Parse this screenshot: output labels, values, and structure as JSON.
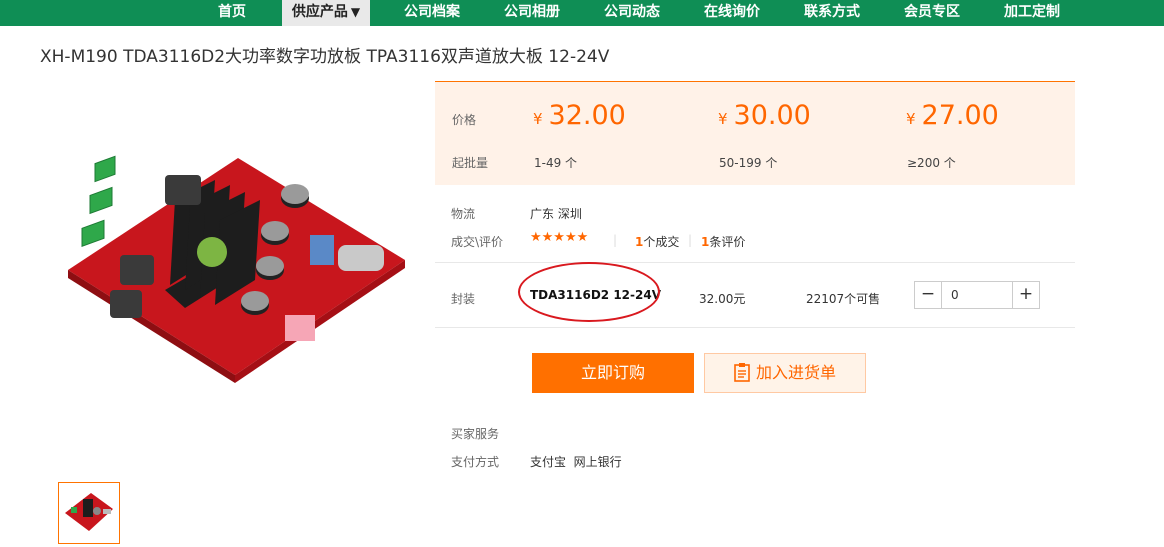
{
  "nav": {
    "items": [
      {
        "label": "首页"
      },
      {
        "label": "供应产品",
        "active": true
      },
      {
        "label": "公司档案"
      },
      {
        "label": "公司相册"
      },
      {
        "label": "公司动态"
      },
      {
        "label": "在线询价"
      },
      {
        "label": "联系方式"
      },
      {
        "label": "会员专区"
      },
      {
        "label": "加工定制"
      }
    ],
    "dropdown_icon": "caret-down-icon"
  },
  "product": {
    "title": "XH-M190 TDA3116D2大功率数字功放板 TPA3116双声道放大板 12-24V"
  },
  "pricing": {
    "price_label": "价格",
    "moq_label": "起批量",
    "currency": "¥",
    "tiers": [
      {
        "price": "32.00",
        "range": "1-49 个"
      },
      {
        "price": "30.00",
        "range": "50-199 个"
      },
      {
        "price": "27.00",
        "range": "≥200 个"
      }
    ]
  },
  "logistics": {
    "label": "物流",
    "value": "广东 深圳"
  },
  "reviews": {
    "label": "成交\\评价",
    "stars": "★★★★★",
    "deals_count": "1",
    "deals_text": "个成交",
    "review_count": "1",
    "review_text": "条评价"
  },
  "package": {
    "label": "封装",
    "spec": "TDA3116D2 12-24V",
    "price": "32.00元",
    "stock": "22107个可售",
    "quantity": "0",
    "minus": "−",
    "plus": "+"
  },
  "actions": {
    "buy": "立即订购",
    "cart": "加入进货单",
    "cart_icon": "clipboard-icon"
  },
  "services": {
    "buyer_label": "买家服务",
    "payment_label": "支付方式",
    "payment_methods": "支付宝  网上银行"
  },
  "colors": {
    "nav_green": "#0f8e55",
    "accent_orange": "#ff6600",
    "price_bg": "#fff2e8",
    "highlight_red": "#d9191f"
  }
}
